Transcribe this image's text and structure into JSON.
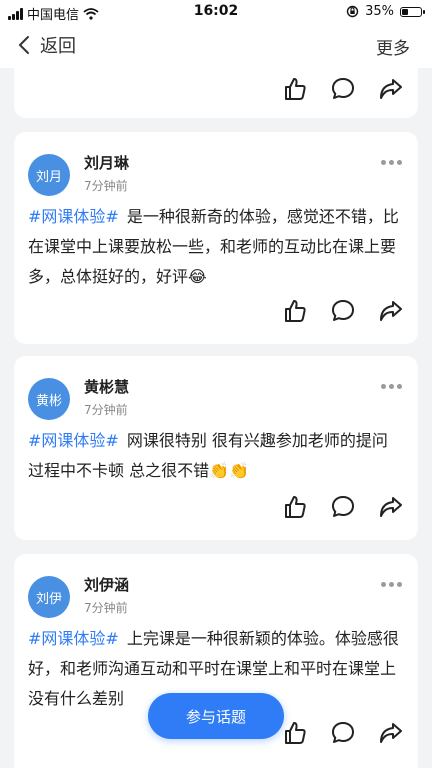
{
  "status_bar": {
    "carrier": "中国电信",
    "time": "16:02",
    "battery": "35%",
    "battery_level": 0.35,
    "icons": [
      "signal-icon",
      "wifi-icon",
      "orientation-lock-icon",
      "battery-icon"
    ]
  },
  "nav": {
    "back_label": "返回",
    "more_label": "更多"
  },
  "posts": [
    {
      "avatar": "刘月",
      "name": "刘月琳",
      "time": "7分钟前",
      "topic": "#网课体验#",
      "text": "是一种很新奇的体验，感觉还不错，比在课堂中上课要放松一些，和老师的互动比在课上要多，总体挺好的，好评😂"
    },
    {
      "avatar": "黄彬",
      "name": "黄彬慧",
      "time": "7分钟前",
      "topic": "#网课体验#",
      "text": "网课很特别 很有兴趣参加老师的提问 过程中不卡顿 总之很不错👏👏"
    },
    {
      "avatar": "刘伊",
      "name": "刘伊涵",
      "time": "7分钟前",
      "topic": "#网课体验#",
      "text": "上完课是一种很新颖的体验。体验感很好，和老师沟通互动和平时在课堂上和平时在课堂上没有什么差别"
    }
  ],
  "join_button_label": "参与话题",
  "colors": {
    "accent": "#2f7cf6",
    "avatar_bg": "#4a90e2",
    "page_bg": "#f2f3f5"
  }
}
